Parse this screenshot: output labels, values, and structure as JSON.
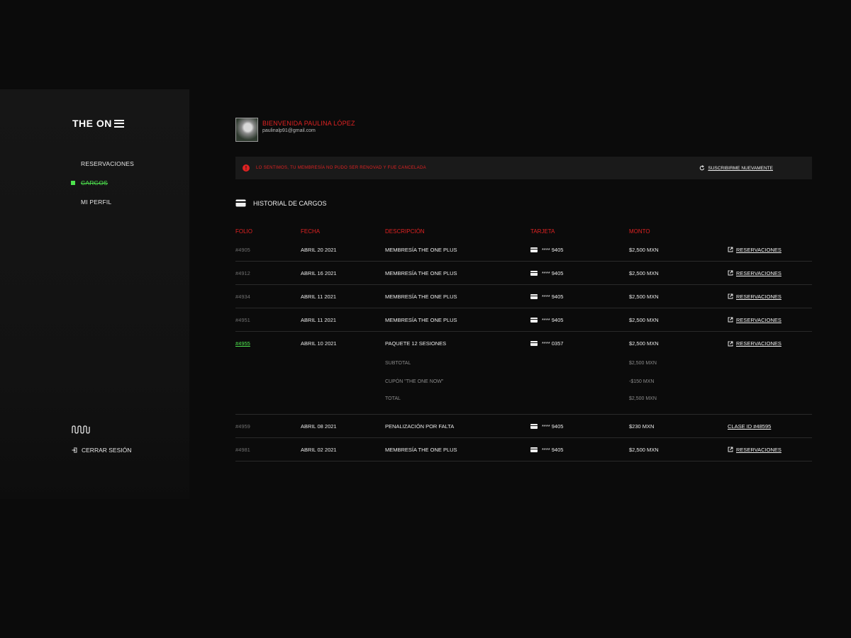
{
  "brand": {
    "name": "THE ON"
  },
  "nav": {
    "items": [
      {
        "label": "RESERVACIONES"
      },
      {
        "label": "CARGOS"
      },
      {
        "label": "MI PERFIL"
      }
    ],
    "logout_label": "CERRAR SESIÓN"
  },
  "profile": {
    "welcome": "BIENVENIDA PAULINA LÓPEZ",
    "email": "paulinalp91@gmail.com"
  },
  "alert": {
    "icon": "!",
    "message": "LO SENTIMOS, TU MEMBRESÍA NO PUDO SER RENOVAD Y FUE CANCELADA",
    "action": "SUSCRIBIRME NUEVAMENTE"
  },
  "history": {
    "title": "HISTORIAL DE CARGOS",
    "columns": [
      "FOLIO",
      "FECHA",
      "DESCRIPCIÓN",
      "TARJETA",
      "MONTO"
    ],
    "rows": [
      {
        "folio": "#4905",
        "fecha": "ABRIL 20 2021",
        "desc": "MEMBRESÍA THE ONE PLUS",
        "card": "**** 9405",
        "monto": "$2,500 MXN",
        "link": "RESERVACIONES"
      },
      {
        "folio": "#4912",
        "fecha": "ABRIL 16 2021",
        "desc": "MEMBRESÍA THE ONE PLUS",
        "card": "**** 9405",
        "monto": "$2,500 MXN",
        "link": "RESERVACIONES"
      },
      {
        "folio": "#4934",
        "fecha": "ABRIL 11 2021",
        "desc": "MEMBRESÍA THE ONE PLUS",
        "card": "**** 9405",
        "monto": "$2,500 MXN",
        "link": "RESERVACIONES"
      },
      {
        "folio": "#4951",
        "fecha": "ABRIL 11 2021",
        "desc": "MEMBRESÍA THE ONE PLUS",
        "card": "**** 9405",
        "monto": "$2,500 MXN",
        "link": "RESERVACIONES"
      },
      {
        "folio": "#4955",
        "fecha": "ABRIL 10 2021",
        "desc": "PAQUETE 12 SESIONES",
        "card": "**** 0357",
        "monto": "$2,500 MXN",
        "link": "RESERVACIONES"
      },
      {
        "folio": "#4959",
        "fecha": "ABRIL 08 2021",
        "desc": "PENALIZACIÓN POR FALTA",
        "card": "**** 9405",
        "monto": "$230 MXN",
        "link": "CLASE ID #48595"
      },
      {
        "folio": "#4981",
        "fecha": "ABRIL 02 2021",
        "desc": "MEMBRESÍA THE ONE PLUS",
        "card": "**** 9405",
        "monto": "$2,500 MXN",
        "link": "RESERVACIONES"
      }
    ],
    "breakdown": {
      "subtotal_label": "SUBTOTAL",
      "subtotal_value": "$2,500 MXN",
      "coupon_label": "CUPÓN \"THE ONE NOW\"",
      "coupon_value": "-$150 MXN",
      "total_label": "TOTAL",
      "total_value": "$2,500 MXN"
    }
  }
}
